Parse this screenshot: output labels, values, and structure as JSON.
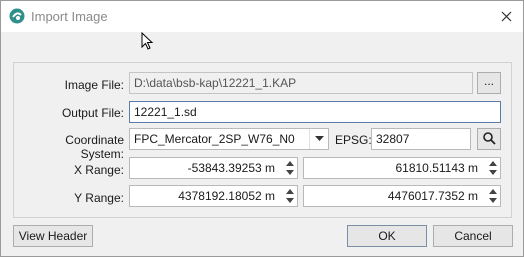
{
  "window": {
    "title": "Import Image",
    "close_icon": "close-icon",
    "app_icon": "app-logo-icon"
  },
  "form": {
    "image_file_label": "Image File:",
    "image_file_value": "D:\\data\\bsb-kap\\12221_1.KAP",
    "browse_label": "...",
    "output_file_label": "Output File:",
    "output_file_value": "12221_1.sd",
    "coordinate_system_label": "Coordinate System:",
    "coordinate_system_value": "FPC_Mercator_2SP_W76_N0",
    "epsg_label": "EPSG:",
    "epsg_value": "32807",
    "search_icon": "search-icon",
    "x_range_label": "X Range:",
    "x_min": "-53843.39253 m",
    "x_max": "61810.51143 m",
    "y_range_label": "Y Range:",
    "y_min": "4378192.18052 m",
    "y_max": "4476017.7352 m"
  },
  "buttons": {
    "view_header": "View Header",
    "ok": "OK",
    "cancel": "Cancel"
  }
}
